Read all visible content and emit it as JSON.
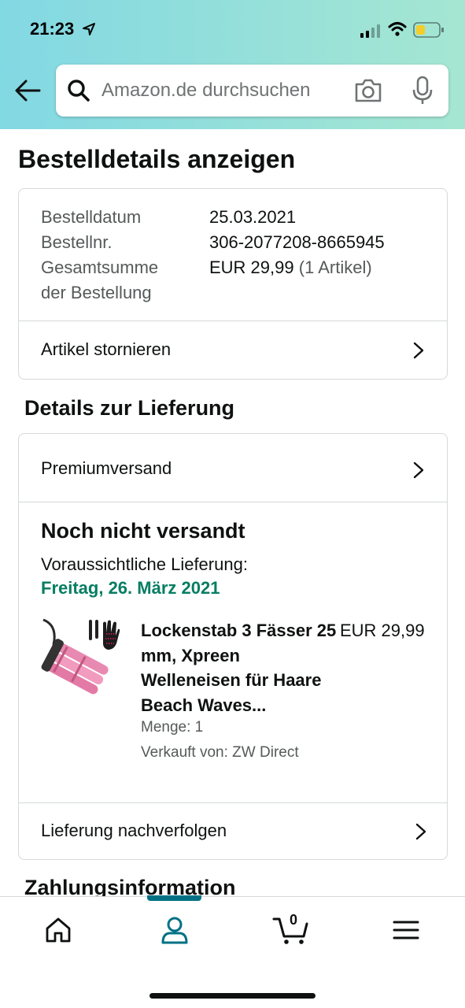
{
  "status_bar": {
    "time": "21:23",
    "icons": [
      "location-arrow-icon",
      "cellular-signal-icon",
      "wifi-icon",
      "battery-icon"
    ]
  },
  "search": {
    "placeholder": "Amazon.de durchsuchen",
    "icons": [
      "back-arrow-icon",
      "search-icon",
      "camera-icon",
      "microphone-icon"
    ]
  },
  "page": {
    "title": "Bestelldetails anzeigen"
  },
  "order_summary": {
    "rows": [
      {
        "label": "Bestelldatum",
        "value": "25.03.2021"
      },
      {
        "label": "Bestellnr.",
        "value": "306-2077208-8665945"
      },
      {
        "label_line1": "Gesamtsumme",
        "label_line2": "der Bestellung",
        "value": "EUR 29,99",
        "value_suffix": "(1 Artikel)"
      }
    ],
    "cancel_link": "Artikel stornieren"
  },
  "delivery": {
    "section_title": "Details zur Lieferung",
    "shipping_method": "Premiumversand",
    "status_title": "Noch nicht versandt",
    "estimate_label": "Voraussichtliche Lieferung:",
    "estimate_date": "Freitag, 26. März 2021",
    "item": {
      "name": "Lockenstab 3 Fässer 25 mm, Xpreen Welleneisen für Haare Beach Waves...",
      "price": "EUR 29,99",
      "quantity": "Menge: 1",
      "seller": "Verkauft von: ZW Direct",
      "image_icon": "curling-iron-product-image"
    },
    "track_link": "Lieferung nachverfolgen"
  },
  "payment": {
    "section_title": "Zahlungsinformation"
  },
  "bottom_nav": {
    "items": [
      "home-icon",
      "account-icon",
      "cart-icon",
      "menu-icon"
    ],
    "active": "account-icon",
    "cart_count": "0"
  },
  "colors": {
    "header_gradient_start": "#82d8e3",
    "header_gradient_end": "#a5e6d2",
    "delivery_date": "#067d62",
    "active_nav": "#007185",
    "text_primary": "#0f1111",
    "text_secondary": "#565959",
    "border": "#d5d9d9"
  }
}
